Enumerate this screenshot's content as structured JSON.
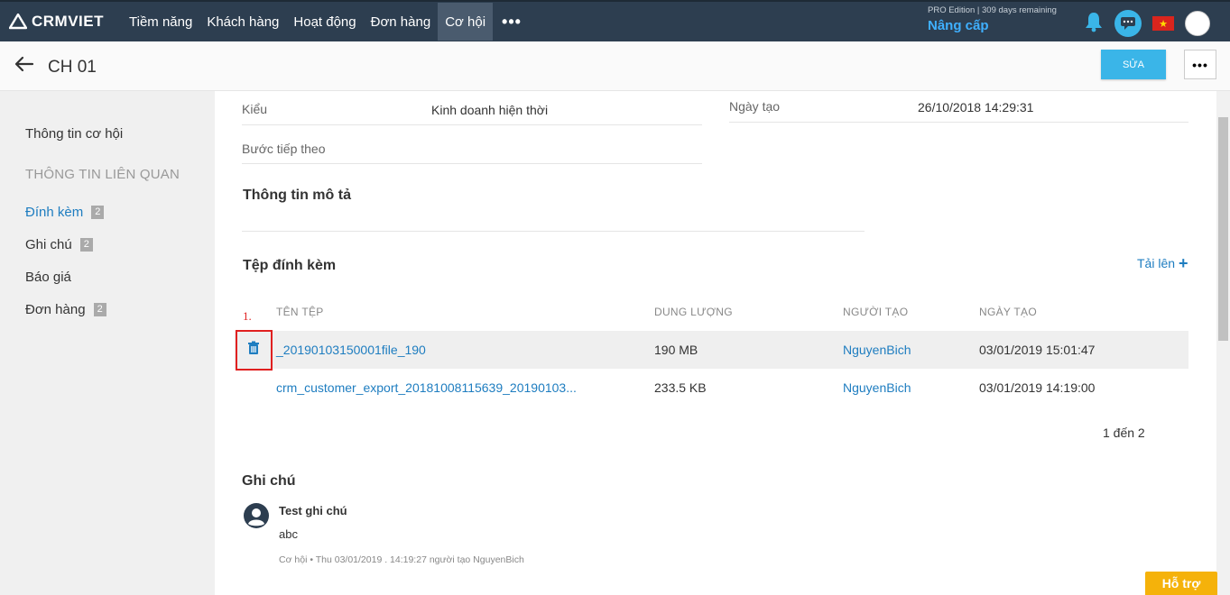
{
  "nav": {
    "logo": "CRMVIET",
    "items": [
      {
        "label": "Tiềm năng"
      },
      {
        "label": "Khách hàng"
      },
      {
        "label": "Hoạt động"
      },
      {
        "label": "Đơn hàng"
      },
      {
        "label": "Cơ hội",
        "active": true
      }
    ],
    "more": "•••",
    "edition": "PRO Edition | 309 days remaining",
    "upgrade": "Nâng cấp"
  },
  "header": {
    "title": "CH 01",
    "edit_label": "SỬA",
    "more_label": "•••"
  },
  "sidebar": {
    "info": "Thông tin cơ hội",
    "section": "THÔNG TIN LIÊN QUAN",
    "items": [
      {
        "label": "Đính kèm",
        "badge": "2"
      },
      {
        "label": "Ghi chú",
        "badge": "2"
      },
      {
        "label": "Báo giá"
      },
      {
        "label": "Đơn hàng",
        "badge": "2"
      }
    ]
  },
  "fields": {
    "kieu_label": "Kiểu",
    "kieu_value": "Kinh doanh hiện thời",
    "buoc_label": "Bước tiếp theo",
    "ngay_tao_label": "Ngày tạo",
    "ngay_tao_value": "26/10/2018 14:29:31"
  },
  "description": {
    "title": "Thông tin mô tả"
  },
  "attachments": {
    "title": "Tệp đính kèm",
    "upload_label": "Tải lên",
    "columns": [
      "TÊN TỆP",
      "DUNG LƯỢNG",
      "NGƯỜI TẠO",
      "NGÀY TẠO"
    ],
    "rows": [
      {
        "name": "_20190103150001file_190",
        "size": "190 MB",
        "creator": "NguyenBich",
        "date": "03/01/2019 15:01:47"
      },
      {
        "name": "crm_customer_export_20181008115639_20190103...",
        "size": "233.5 KB",
        "creator": "NguyenBich",
        "date": "03/01/2019 14:19:00"
      }
    ],
    "pagination": "1 đến 2",
    "annotation": "1."
  },
  "notes": {
    "title": "Ghi chú",
    "items": [
      {
        "title": "Test ghi chú",
        "body": "abc",
        "meta": "Cơ hội   •   Thu 03/01/2019 . 14:19:27  người tạo  NguyenBich"
      }
    ]
  },
  "support": {
    "label": "Hỗ trợ"
  },
  "colors": {
    "nav_bg": "#2d3e50",
    "accent": "#3ab5e8",
    "link": "#1e7dc0",
    "support": "#f5b20a",
    "annotation": "#e02020"
  }
}
